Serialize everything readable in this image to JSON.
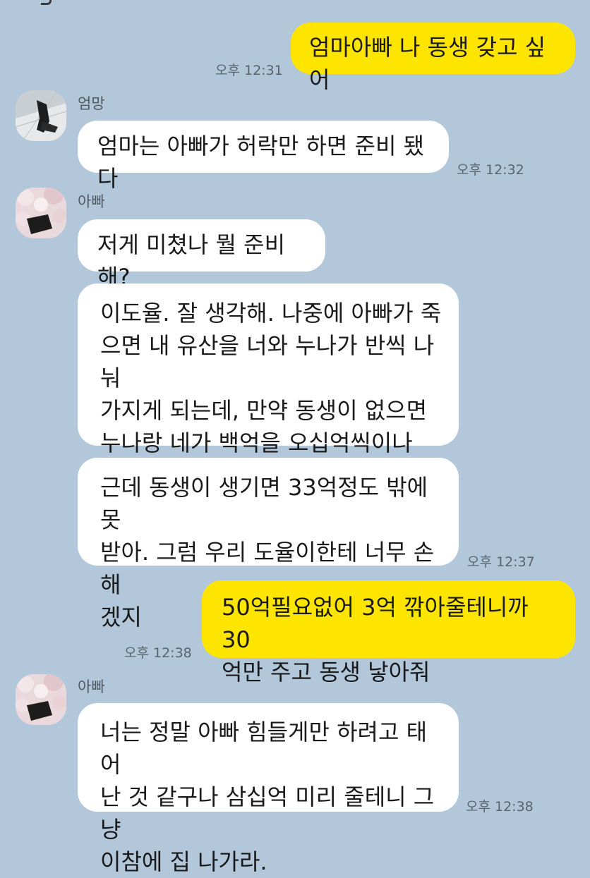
{
  "chat": {
    "messages": [
      {
        "id": "m1",
        "side": "sent",
        "text": "엄마아빠 나 동생 갖고 싶어",
        "time": "오후 12:31"
      },
      {
        "id": "m2",
        "side": "received",
        "sender": "엄망",
        "avatar": "profile-photo-mom",
        "text": "엄마는 아빠가 허락만 하면 준비 됐다",
        "time": "오후 12:32"
      },
      {
        "id": "m3",
        "side": "received",
        "sender": "아빠",
        "avatar": "profile-photo-dad",
        "text": "저게 미쳤나 뭘 준비해?"
      },
      {
        "id": "m4",
        "side": "received",
        "text": "이도율. 잘 생각해. 나중에 아빠가 죽\n으면 내 유산을 너와 누나가 반씩 나눠\n가지게 되는데, 만약 동생이 없으면\n누나랑 네가 백억을 오십억씩이나\n나눠가질 수 있어."
      },
      {
        "id": "m5",
        "side": "received",
        "text": "근데 동생이 생기면 33억정도 밖에 못\n받아. 그럼 우리 도율이한테 너무 손해\n겠지",
        "time": "오후 12:37"
      },
      {
        "id": "m6",
        "side": "sent",
        "text": "50억필요없어 3억 깎아줄테니까 30\n억만 주고 동생 낳아줘",
        "time": "오후 12:38"
      },
      {
        "id": "m7",
        "side": "received",
        "sender": "아빠",
        "avatar": "profile-photo-dad",
        "text": "너는 정말 아빠 힘들게만 하려고 태어\n난 것 같구나 삼십억 미리 줄테니 그냥\n이참에 집 나가라.",
        "time": "오후 12:38"
      }
    ]
  },
  "colors": {
    "background": "#b2c7da",
    "sent_bubble": "#fee500",
    "received_bubble": "#ffffff",
    "time_text": "#59646e"
  }
}
